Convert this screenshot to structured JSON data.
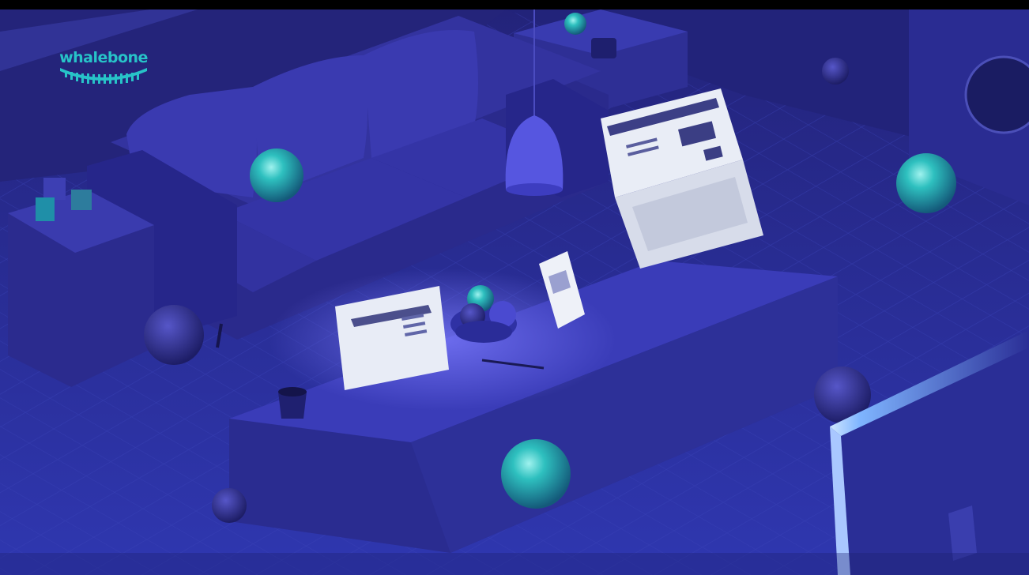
{
  "brand": {
    "name": "whalebone",
    "color": "#27c3c8"
  },
  "scene": {
    "palette": {
      "background": "#2b2a86",
      "floor": "#2a2f9a",
      "furniture": "#2c2c8a",
      "glass_sphere": "#1fb3b3",
      "screen_glow": "#e9eef6"
    }
  }
}
